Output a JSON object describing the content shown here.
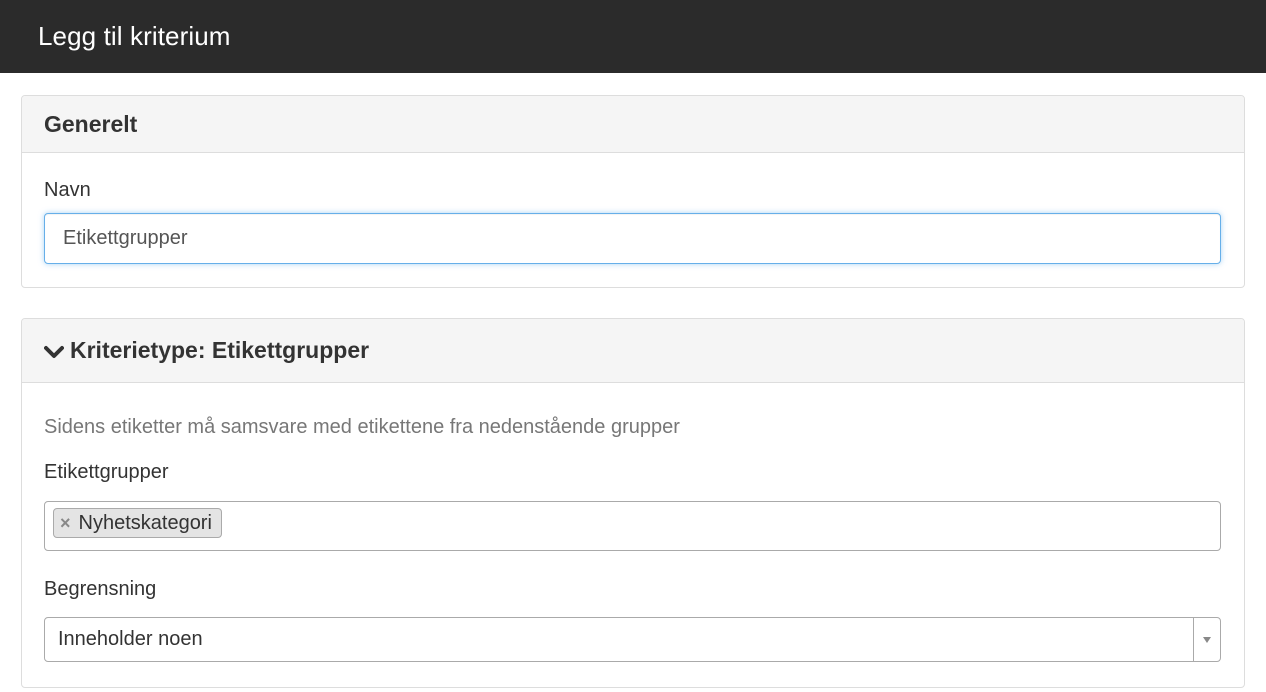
{
  "header": {
    "title": "Legg til kriterium",
    "background": "#2b2b2b"
  },
  "general_panel": {
    "title": "Generelt",
    "name_label": "Navn",
    "name_value": "Etikettgrupper"
  },
  "criteria_panel": {
    "title": "Kriterietype: Etikettgrupper",
    "chevron_icon": "chevron-down-icon",
    "help_text": "Sidens etiketter må samsvare med etikettene fra nedenstående grupper",
    "tag_groups_label": "Etikettgrupper",
    "tags": [
      {
        "remove_symbol": "×",
        "label": "Nyhetskategori"
      }
    ],
    "restriction_label": "Begrensning",
    "restriction_value": "Inneholder noen"
  }
}
